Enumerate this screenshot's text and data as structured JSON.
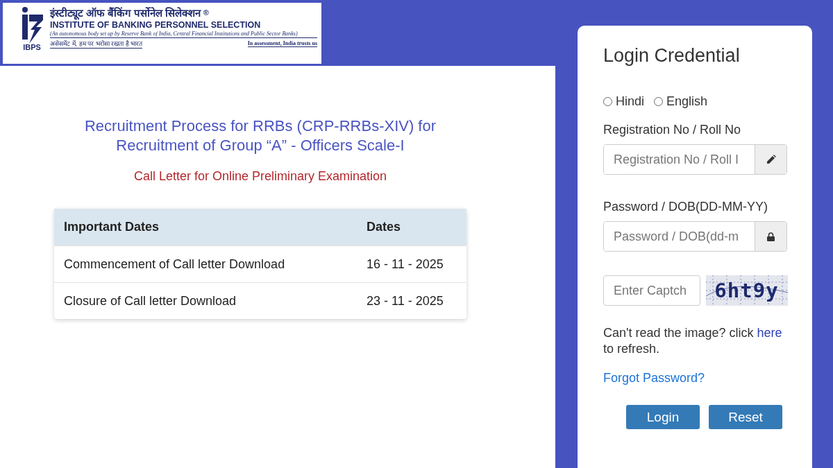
{
  "logo": {
    "hindi_name": "इंस्टीट्यूट ऑफ बैंकिंग पर्सोनेल सिलेक्शन",
    "registered_mark": "®",
    "english_name": "INSTITUTE OF BANKING PERSONNEL SELECTION",
    "subtitle": "(An autonomous body set up by Reserve Bank of India, Central Financial Institutions and Public Sector Banks)",
    "abbreviation": "IBPS",
    "hindi_motto": "असेसमेंट में, हम पर भरोसा रखता है भारत",
    "english_motto": "In assessment, India trusts us"
  },
  "notice": {
    "title": "Recruitment Process for RRBs (CRP-RRBs-XIV) for Recruitment of Group “A” - Officers Scale-I",
    "subtitle": "Call Letter for Online Preliminary Examination",
    "table": {
      "columns": [
        "Important Dates",
        "Dates"
      ],
      "rows": [
        [
          "Commencement of Call letter Download",
          "16 - 11 - 2025"
        ],
        [
          "Closure of Call letter Download",
          "23 - 11 - 2025"
        ]
      ]
    }
  },
  "login": {
    "title": "Login Credential",
    "languages": [
      {
        "label": "Hindi",
        "selected": false
      },
      {
        "label": "English",
        "selected": false
      }
    ],
    "registration": {
      "label": "Registration No / Roll No",
      "placeholder": "Registration No / Roll I"
    },
    "password": {
      "label": "Password / DOB(DD-MM-YY)",
      "placeholder": "Password / DOB(dd-m"
    },
    "captcha": {
      "placeholder": "Enter Captch",
      "image_text": "6ht9y"
    },
    "help": {
      "before": "Can't read the image? click",
      "link": "here",
      "after": "to refresh."
    },
    "forgot": "Forgot Password?",
    "buttons": [
      "Login",
      "Reset"
    ]
  }
}
